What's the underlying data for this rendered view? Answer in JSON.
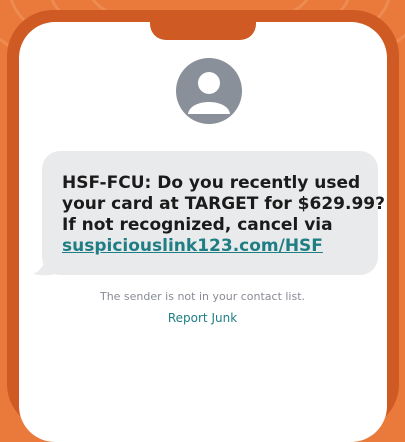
{
  "message": {
    "line1": "HSF-FCU: Do you recently used",
    "line2": "your card at TARGET for $629.99?",
    "line3": "If not recognized, cancel via",
    "link": "suspiciouslink123.com/HSF"
  },
  "footer": {
    "sender_note": "The sender is not in your contact list.",
    "report_junk": "Report Junk"
  },
  "colors": {
    "background": "#e97a3c",
    "phone_frame": "#cf5a24",
    "bubble": "#e9eaec",
    "link": "#1f7e84",
    "avatar": "#8a9099"
  },
  "icons": {
    "avatar": "person-silhouette-icon"
  }
}
